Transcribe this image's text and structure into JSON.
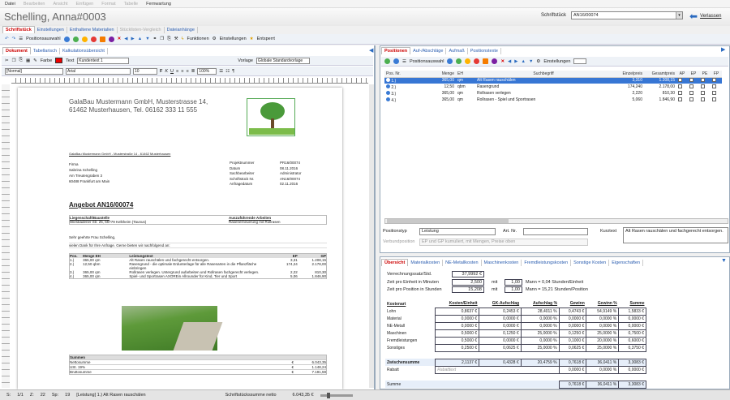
{
  "menu": [
    "Datei",
    "Bearbeiten",
    "Ansicht",
    "Einfügen",
    "Format",
    "Tabelle",
    "Fernwartung"
  ],
  "app": {
    "title": "Schelling, Anna#0003",
    "doc_label": "Schriftstück",
    "doc_value": "AN16/00074",
    "leave": "Verlassen"
  },
  "main_tabs": [
    "Schriftstück",
    "Einstellungen",
    "Enthaltene Materialien",
    "Stücklisten-Vergleich",
    "Dateianhänge"
  ],
  "toolbar": {
    "pos": "Positionsauswahl",
    "funcs": "Funktionen",
    "settings": "Einstellungen",
    "unlock": "Entsperrt"
  },
  "left_tabs": [
    "Dokument",
    "Tabellarisch",
    "Kalkulationsübersicht"
  ],
  "fmt": {
    "farbe": "Farbe",
    "text": "Text",
    "style": "Kundentext 1",
    "para": "[Normal]",
    "font": "Arial",
    "size": "10",
    "bold": "F",
    "italic": "K",
    "under": "U",
    "zoom": "100%",
    "vorlage_label": "Vorlage",
    "vorlage": "Globale Standardvorlage"
  },
  "letter": {
    "company_line1": "GalaBau Mustermann GmbH, Musterstrasse 14,",
    "company_line2": "61462 Musterhausen, Tel. 06162 333 11 555",
    "sender": "GalaBau Mustermann GmbH - Musterstraße 14 - 61462 Musterhausen",
    "addr": [
      "Firma",
      "Sabrina Schelling",
      "Am Treutengraben 3",
      "60488 Frankfurt am Main"
    ],
    "meta": [
      [
        "Projektnummer",
        "PR16/00074"
      ],
      [
        "Datum",
        "08.11.2016"
      ],
      [
        "Sachbearbeiter",
        "Administrator"
      ],
      [
        "Schriftstück Nr.",
        "AN16/00074"
      ],
      [
        "Anfragedatum",
        "02.11.2016"
      ]
    ],
    "heading": "Angebot AN16/00074",
    "site_h": "Liegenschaft/Baustelle",
    "site": "Wiesbadener Str. 25, 65779 Kelkheim (Taunus)",
    "work_h": "Auszuführende Arbeiten",
    "work": "Rasenerneuerung mit Rollrasen",
    "greet": "Sehr geehrte Frau Schelling,",
    "intro": "vielen Dank für Ihre Anfrage. Gerne bieten wir nachfolgend an:",
    "th": [
      "Pos.",
      "Menge EH",
      "Leistungstext",
      "EP",
      "GP"
    ],
    "rows": [
      [
        "1.)",
        "365,00 qm",
        "Alt Rasen rauschälen und fachgerecht entsorgen.",
        "3,31",
        "1.208,15"
      ],
      [
        "2.)",
        "12,50 qbm",
        "Rasengrund - die optimale Erdunterlage für alle Rasenarten in die Pflanzfläche einbringen",
        "174,24",
        "2.178,00"
      ],
      [
        "3.)",
        "365,00 qm",
        "Rollrasen verlegen. Untergrund aufarbeiten und Rollrasen fachgerecht verlegen.",
        "2,22",
        "810,30"
      ],
      [
        "4.)",
        "365,00 qm",
        "Spiel- und Sportrasen AXOREin Allrounder für Kind, Tier und Sport",
        "5,06",
        "1.846,90"
      ]
    ],
    "sum_h": "Summen",
    "sums": [
      [
        "Nettosumme",
        "€",
        "6.043,35"
      ],
      [
        "USt. 19%",
        "€",
        "1.148,24"
      ],
      [
        "Bruttosumme",
        "€",
        "7.191,59"
      ]
    ]
  },
  "pos_tabs": [
    "Positionen",
    "Auf-/Abschläge",
    "Aufmaß",
    "Positionstexte"
  ],
  "pos_toolbar": {
    "pos": "Positionsauswahl",
    "settings": "Einstellungen"
  },
  "grid": {
    "cols": [
      "Pos. Nr.",
      "Menge",
      "EH",
      "Suchbegriff",
      "Einzelpreis",
      "Gesamtpreis",
      "AP",
      "EP",
      "PE",
      "FP"
    ],
    "rows": [
      [
        "1.)",
        "365,00",
        "qm",
        "Alt Rasen rauschälen",
        "3,310",
        "1.208,15"
      ],
      [
        "2.)",
        "12,50",
        "qbm",
        "Rasengrund",
        "174,240",
        "2.178,00"
      ],
      [
        "3.)",
        "365,00",
        "qm",
        "Rollrasen verlegen",
        "2,220",
        "810,30"
      ],
      [
        "4.)",
        "365,00",
        "qm",
        "Rollrasen - Spiel und Sportrasen",
        "5,060",
        "1.846,90"
      ]
    ]
  },
  "detail": {
    "typ_label": "Positionstyp",
    "typ": "Leistung",
    "art_label": "Art. Nr.",
    "kurz_label": "Kurztext",
    "kurz": "Alt Rasen rauschälen und fachgerecht entsorgen.",
    "vpos_label": "Verbundposition",
    "vpos": "EP und GP kumuliert, mit Mengen, Preise oben"
  },
  "calc_tabs": [
    "Übersicht",
    "Materialkosten",
    "NE-Metallkosten",
    "Maschinenkosten",
    "Fremdleistungskosten",
    "Sonstige Kosten",
    "Eigenschaften"
  ],
  "calc": {
    "vrs_label": "Verrechnungssatz/Std.",
    "vrs": "37,9992 €",
    "zpe_label": "Zeit pro Einheit in Minuten",
    "zpe": "2,500",
    "mit": "mit",
    "zpe_m": "1,00",
    "zpe_res": "Mann = 0,04 Stunden/Einheit",
    "zpp_label": "Zeit pro Position in Stunden",
    "zpp": "15,208",
    "zpp_m": "1,00",
    "zpp_res": "Mann = 15,21 Stunden/Position",
    "cols": [
      "Kostenart",
      "Kosten/Einheit",
      "GK-Aufschlag",
      "Aufschlag %",
      "Gewinn",
      "Gewinn %",
      "Summe"
    ],
    "rows": [
      [
        "Lohn",
        "0,8637 €",
        "0,2453 €",
        "28,4011 %",
        "0,4743 €",
        "54,9149 %",
        "1,5833 €"
      ],
      [
        "Material",
        "0,0000 €",
        "0,0000 €",
        "0,0000 %",
        "0,0000 €",
        "0,0000 %",
        "0,0000 €"
      ],
      [
        "NE-Metall",
        "0,0000 €",
        "0,0000 €",
        "0,0000 %",
        "0,0000 €",
        "0,0000 %",
        "0,0000 €"
      ],
      [
        "Maschinen",
        "0,5000 €",
        "0,1250 €",
        "25,0000 %",
        "0,1250 €",
        "25,0000 %",
        "0,7500 €"
      ],
      [
        "Fremdleistungen",
        "0,5000 €",
        "0,0000 €",
        "0,0000 %",
        "0,1000 €",
        "20,0000 %",
        "0,6000 €"
      ],
      [
        "Sonstiges",
        "0,2500 €",
        "0,0625 €",
        "25,0000 %",
        "0,0625 €",
        "25,0000 %",
        "0,3750 €"
      ]
    ],
    "zw": [
      "Zwischensumme",
      "2,1137 €",
      "0,4328 €",
      "20,4759 %",
      "0,7618 €",
      "36,0411 %",
      "3,3083 €"
    ],
    "rab_label": "Rabatt",
    "rab_ph": "Rabatttext",
    "rab": [
      "0,0000 €",
      "0,0000 %",
      "0,0000 €"
    ],
    "sum": [
      "Summe",
      "0,7618 €",
      "36,0411 %",
      "3,3083 €"
    ]
  },
  "status": {
    "s": "S:",
    "s_v": "1/1",
    "z": "Z:",
    "z_v": "22",
    "sp": "Sp:",
    "sp_v": "19",
    "ctx": "[Leistung]  1.) Alt Rasen rauschälen",
    "total_label": "Schriftstückssumme netto",
    "total": "6.043,35 €"
  }
}
